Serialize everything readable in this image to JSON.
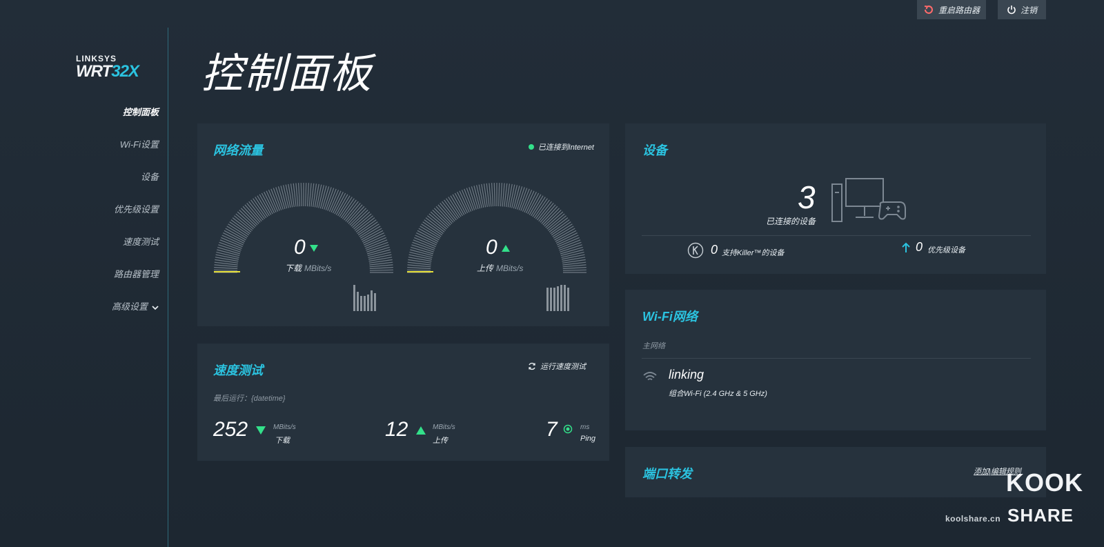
{
  "top": {
    "reboot_label": "重启路由器",
    "logout_label": "注销"
  },
  "logo": {
    "line1": "LINKSYS",
    "line2a": "WRT",
    "line2b": "32X"
  },
  "nav": {
    "items": [
      "控制面板",
      "Wi-Fi设置",
      "设备",
      "优先级设置",
      "速度测试",
      "路由器管理",
      "高级设置"
    ]
  },
  "page_title": "控制面板",
  "traffic": {
    "title": "网络流量",
    "status": "已连接到Internet",
    "download": {
      "value": "0",
      "label": "下载",
      "unit": "MBits/s"
    },
    "upload": {
      "value": "0",
      "label": "上传",
      "unit": "MBits/s"
    }
  },
  "speedtest": {
    "title": "速度测试",
    "run_label": "运行速度测试",
    "last_run": "最后运行：{datetime}",
    "download": {
      "value": "252",
      "unit": "MBits/s",
      "label": "下载"
    },
    "upload": {
      "value": "12",
      "unit": "MBits/s",
      "label": "上传"
    },
    "ping": {
      "value": "7",
      "unit": "ms",
      "label": "Ping"
    }
  },
  "devices": {
    "title": "设备",
    "count": "3",
    "count_label": "已连接的设备",
    "killer_count": "0",
    "killer_label": "支持Killer™的设备",
    "priority_count": "0",
    "priority_label": "优先级设备"
  },
  "wifi": {
    "title": "Wi-Fi网络",
    "section": "主网络",
    "ssid": "linking",
    "desc": "组合Wi-Fi (2.4 GHz & 5 GHz)"
  },
  "port": {
    "title": "端口转发",
    "link": "添加|编辑规则"
  },
  "watermark": {
    "site": "koolshare.cn",
    "brand1": "KOOK",
    "brand2": "SHARE"
  },
  "colors": {
    "accent": "#2bc3e0",
    "ok": "#33e08a",
    "card": "#26323d",
    "bg": "#1f2a35"
  }
}
